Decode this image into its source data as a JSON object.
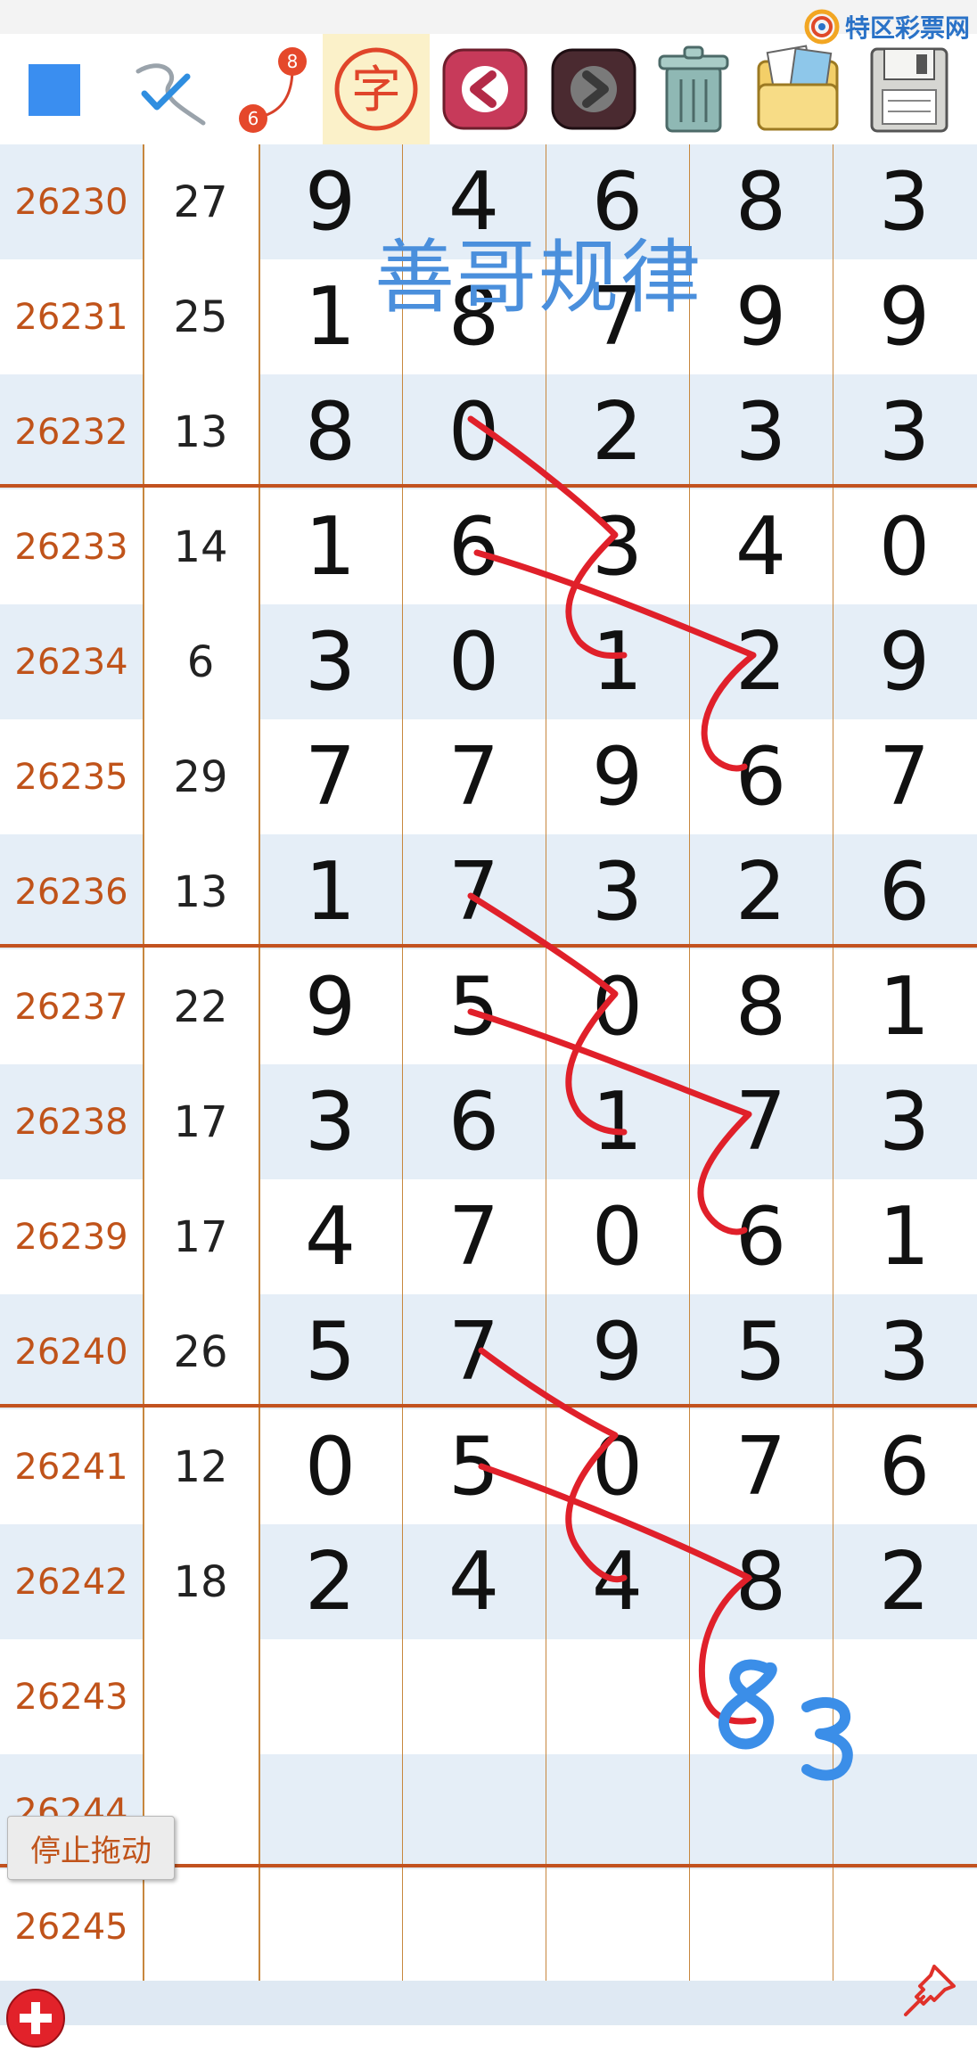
{
  "brand": {
    "text": "特区彩票网"
  },
  "toolbar": {
    "icons": [
      {
        "name": "blue-square-icon"
      },
      {
        "name": "pen-check-icon"
      },
      {
        "name": "connect-6-8-icon",
        "label_a": "6",
        "label_b": "8"
      },
      {
        "name": "text-char-icon",
        "label": "字"
      },
      {
        "name": "back-arrow-icon"
      },
      {
        "name": "forward-arrow-icon"
      },
      {
        "name": "trash-icon"
      },
      {
        "name": "folder-photos-icon"
      },
      {
        "name": "save-disk-icon"
      }
    ]
  },
  "colors": {
    "issue_text": "#c0531a",
    "row_alt": "#e5eef7",
    "separator": "#c2521f",
    "grid_line": "#c7873e",
    "ink_red": "#e0202a",
    "ink_blue": "#3b8ee8"
  },
  "rows": [
    {
      "issue": "26230",
      "sum": "27",
      "digits": [
        "9",
        "4",
        "6",
        "8",
        "3"
      ]
    },
    {
      "issue": "26231",
      "sum": "25",
      "digits": [
        "1",
        "8",
        "7",
        "9",
        "9"
      ]
    },
    {
      "issue": "26232",
      "sum": "13",
      "digits": [
        "8",
        "0",
        "2",
        "3",
        "3"
      ]
    },
    {
      "issue": "26233",
      "sum": "14",
      "digits": [
        "1",
        "6",
        "3",
        "4",
        "0"
      ]
    },
    {
      "issue": "26234",
      "sum": "6",
      "digits": [
        "3",
        "0",
        "1",
        "2",
        "9"
      ]
    },
    {
      "issue": "26235",
      "sum": "29",
      "digits": [
        "7",
        "7",
        "9",
        "6",
        "7"
      ]
    },
    {
      "issue": "26236",
      "sum": "13",
      "digits": [
        "1",
        "7",
        "3",
        "2",
        "6"
      ]
    },
    {
      "issue": "26237",
      "sum": "22",
      "digits": [
        "9",
        "5",
        "0",
        "8",
        "1"
      ]
    },
    {
      "issue": "26238",
      "sum": "17",
      "digits": [
        "3",
        "6",
        "1",
        "7",
        "3"
      ]
    },
    {
      "issue": "26239",
      "sum": "17",
      "digits": [
        "4",
        "7",
        "0",
        "6",
        "1"
      ]
    },
    {
      "issue": "26240",
      "sum": "26",
      "digits": [
        "5",
        "7",
        "9",
        "5",
        "3"
      ]
    },
    {
      "issue": "26241",
      "sum": "12",
      "digits": [
        "0",
        "5",
        "0",
        "7",
        "6"
      ]
    },
    {
      "issue": "26242",
      "sum": "18",
      "digits": [
        "2",
        "4",
        "4",
        "8",
        "2"
      ]
    },
    {
      "issue": "26243",
      "sum": "",
      "digits": [
        "",
        "",
        "",
        "",
        ""
      ]
    },
    {
      "issue": "26244",
      "sum": "",
      "digits": [
        "",
        "",
        "",
        "",
        ""
      ]
    },
    {
      "issue": "26245",
      "sum": "",
      "digits": [
        "",
        "",
        "",
        "",
        ""
      ]
    }
  ],
  "annotations": {
    "watermark": "善哥规律",
    "prediction": "83"
  },
  "stop_drag_label": "停止拖动"
}
